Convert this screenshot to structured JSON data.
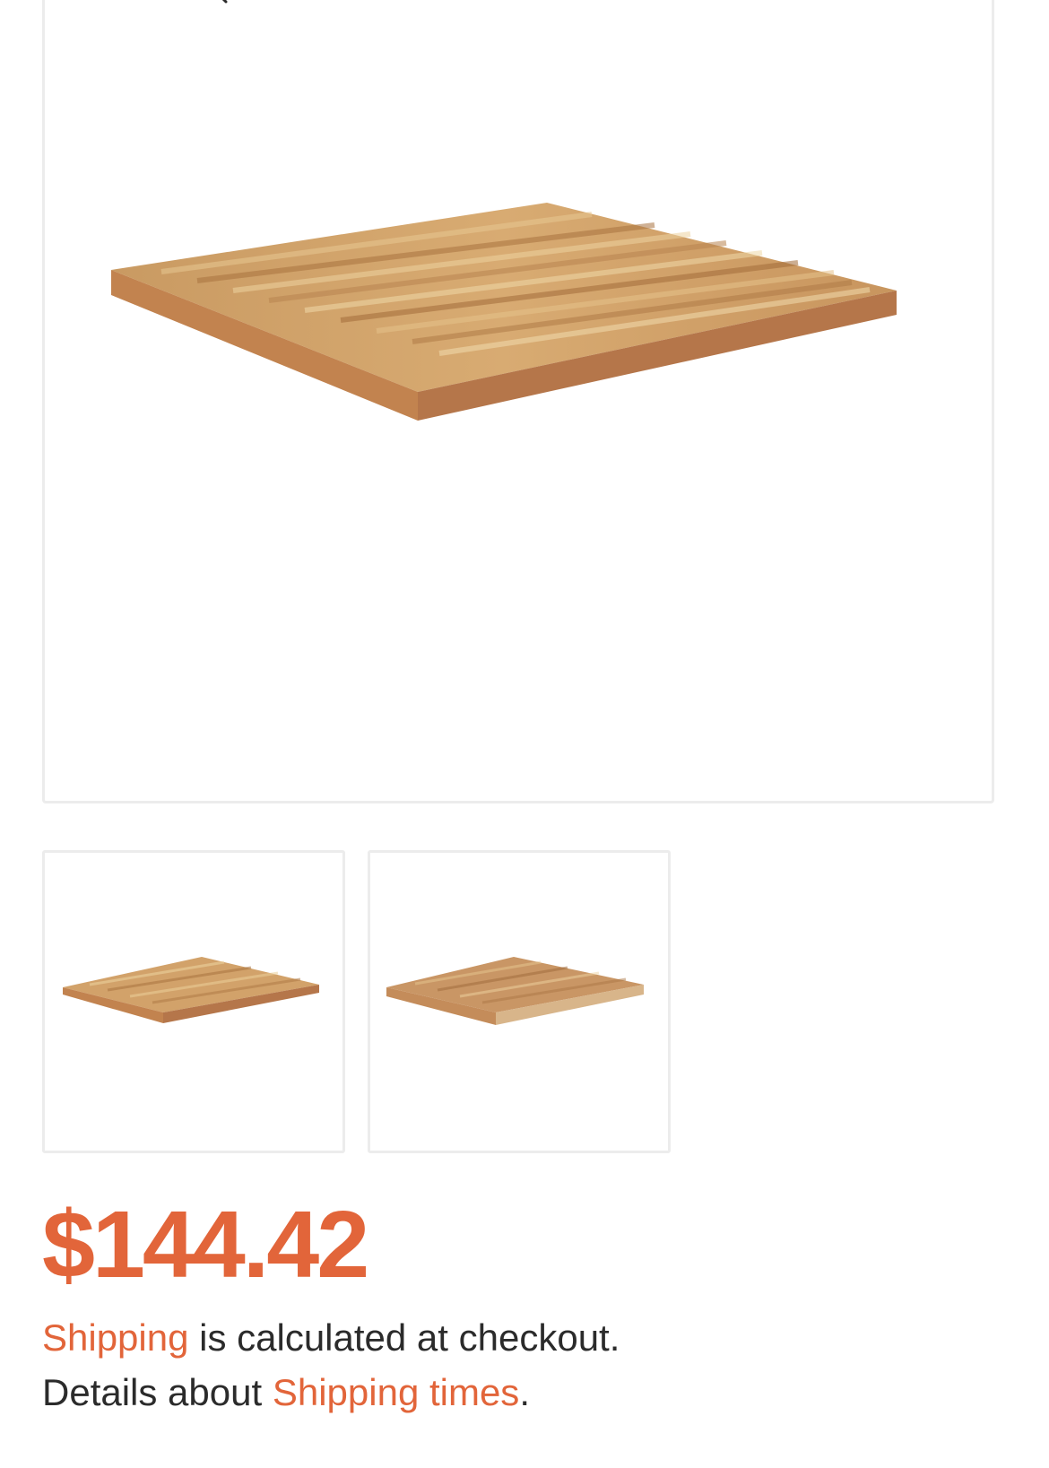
{
  "product": {
    "price": "$144.42",
    "main_image_alt": "Wood table top",
    "thumbnails": [
      {
        "alt": "Wood table top view 1"
      },
      {
        "alt": "Wood table top view 2"
      }
    ]
  },
  "shipping": {
    "link_label": "Shipping",
    "text_after_link": " is calculated at checkout.",
    "details_prefix": "Details about ",
    "times_link_label": "Shipping times",
    "details_suffix": "."
  },
  "colors": {
    "accent": "#e2653a",
    "text": "#2b2b2b",
    "border": "#ececec"
  },
  "icons": {
    "zoom": "magnifier-icon"
  }
}
